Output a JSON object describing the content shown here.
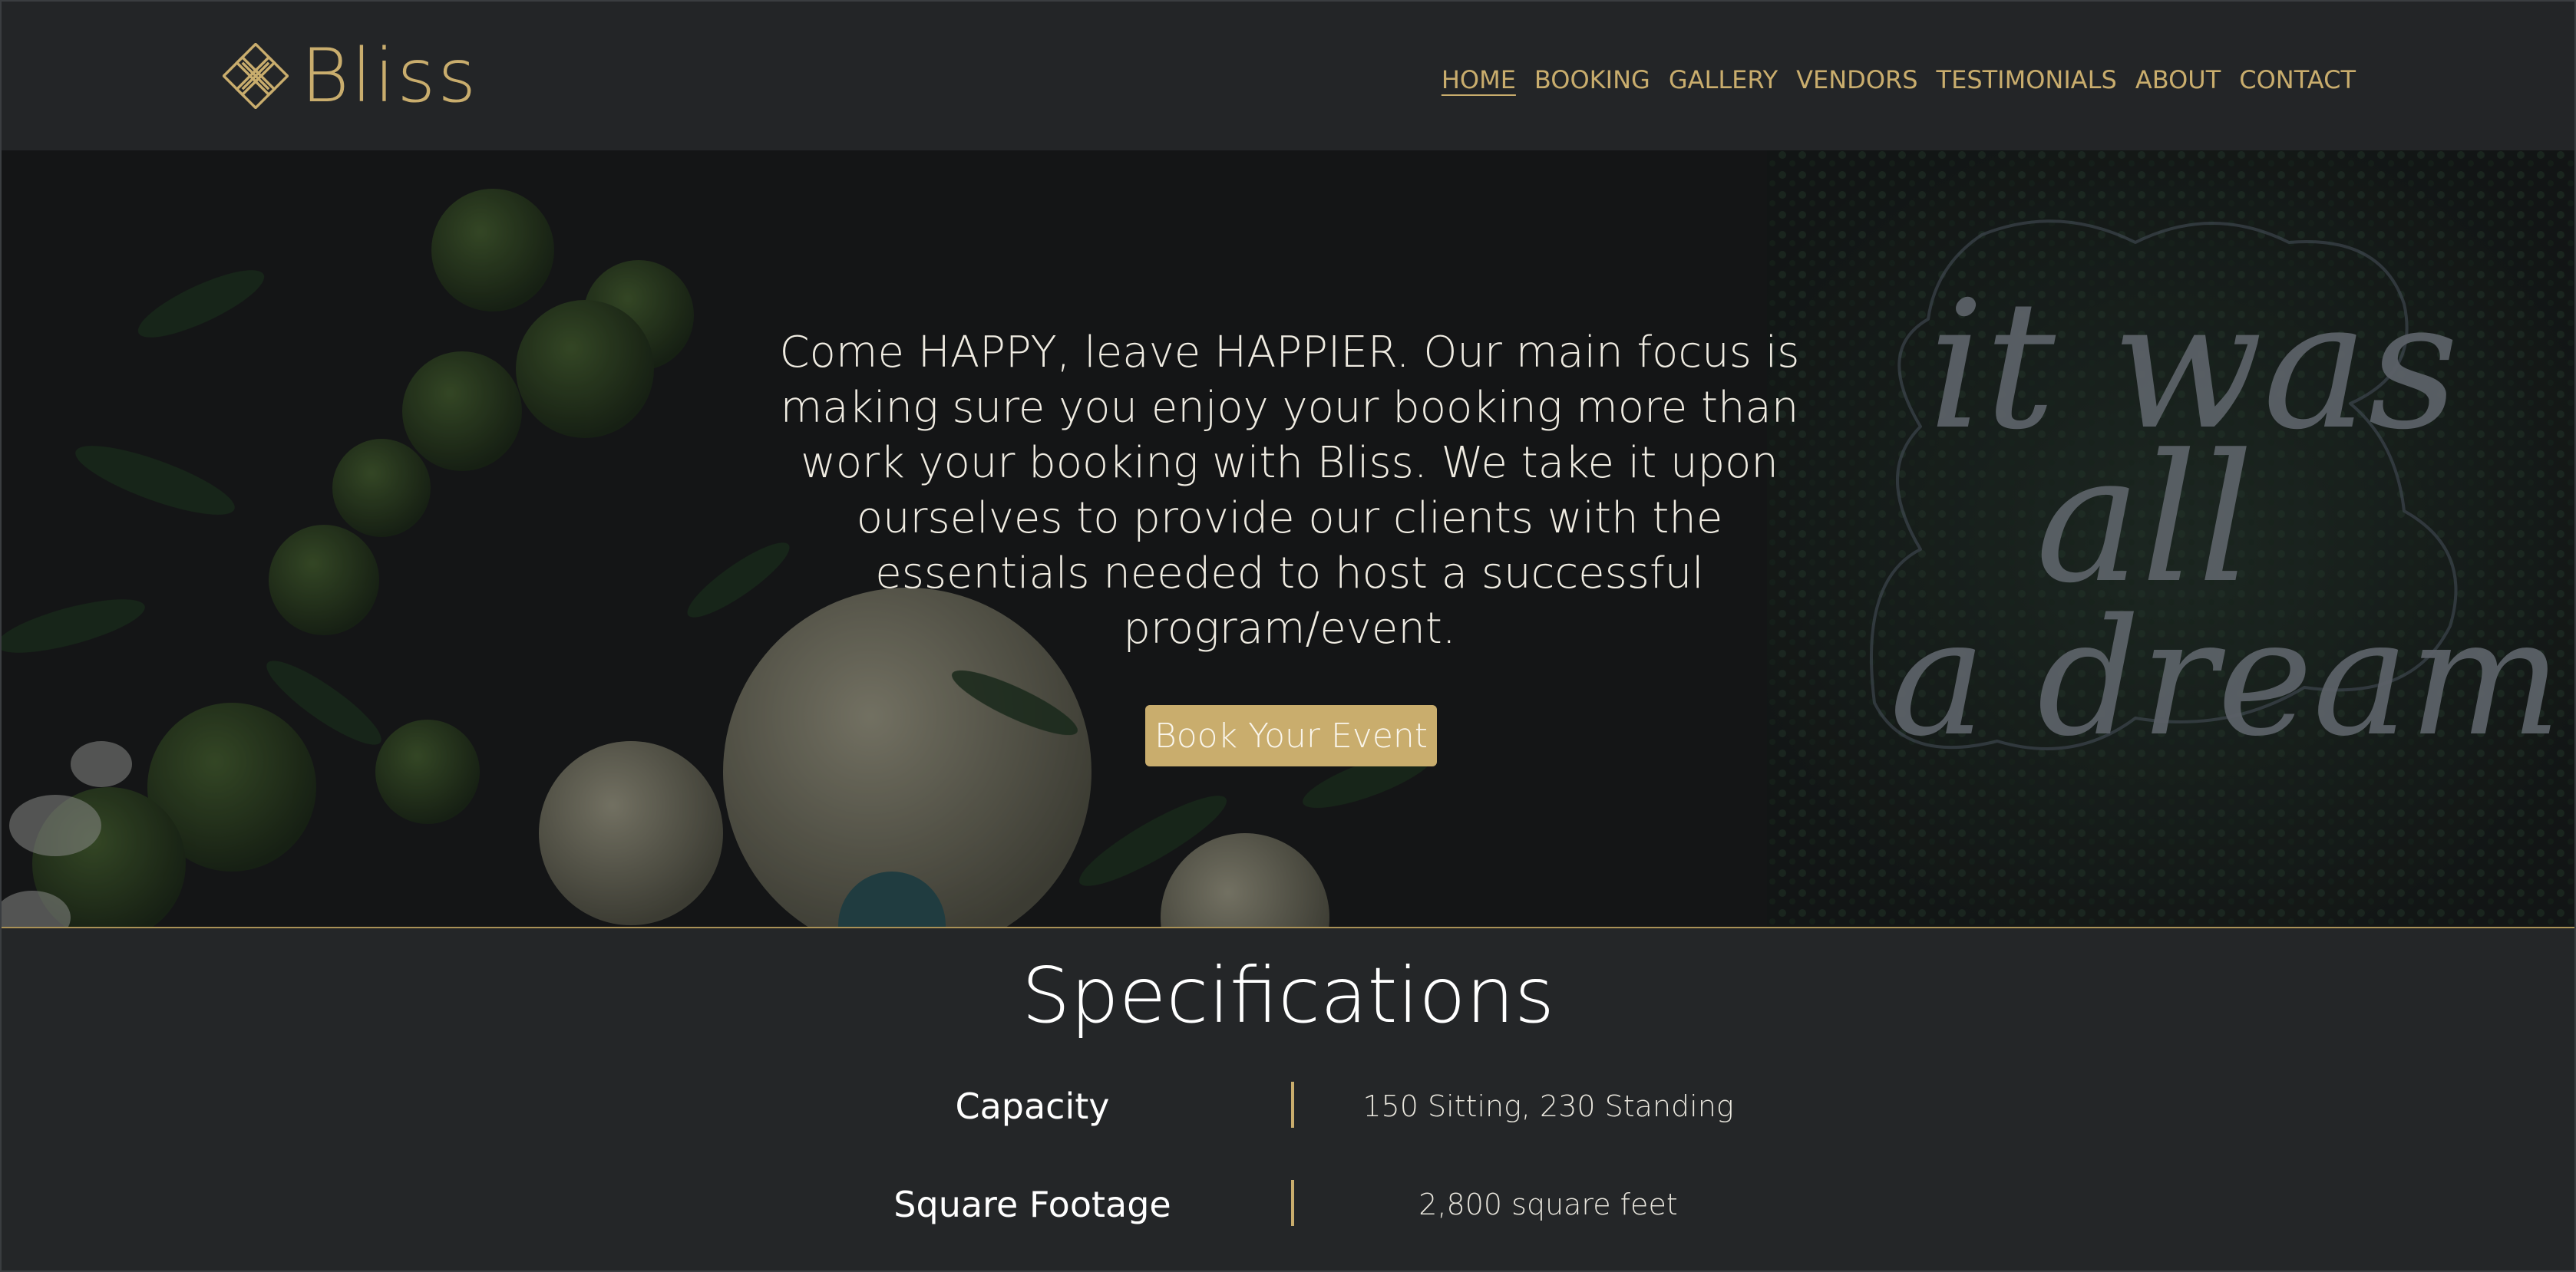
{
  "header": {
    "logo_text": "Bliss",
    "nav": [
      "HOME",
      "BOOKING",
      "GALLERY",
      "VENDORS",
      "TESTIMONIALS",
      "ABOUT",
      "CONTACT"
    ],
    "active_nav": "HOME"
  },
  "hero": {
    "tagline": "Come HAPPY, leave HAPPIER. Our main focus is making sure you enjoy your booking more than work your booking with Bliss. We take it upon ourselves to provide our clients with the essentials needed to host a successful program/event.",
    "cta_label": "Book Your Event",
    "neon_sign_text": "it was all a dream"
  },
  "specifications": {
    "title": "Specifications",
    "rows": [
      {
        "label": "Capacity",
        "value": "150 Sitting, 230 Standing"
      },
      {
        "label": "Square Footage",
        "value": "2,800 square feet"
      }
    ]
  },
  "colors": {
    "accent_gold": "#c9ad6d",
    "background": "#242628",
    "text_light": "#ffffff"
  }
}
